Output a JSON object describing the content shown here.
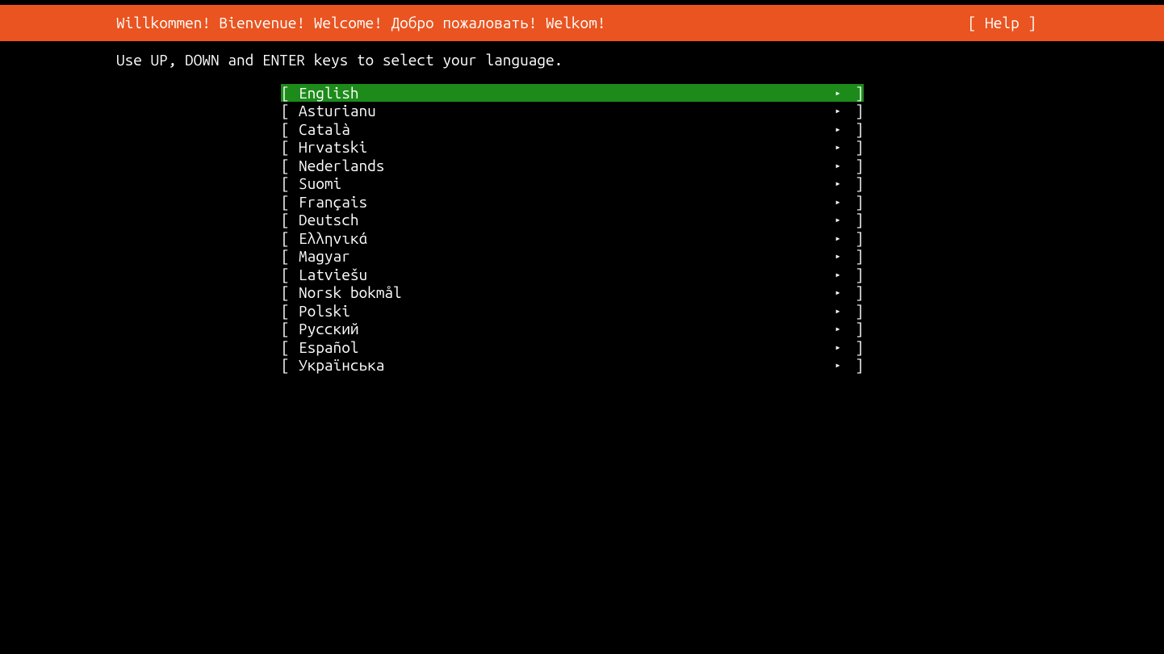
{
  "header": {
    "title": "Willkommen! Bienvenue! Welcome! Добро пожаловать! Welkom!",
    "help_label": "[ Help ]"
  },
  "instruction": "Use UP, DOWN and ENTER keys to select your language.",
  "languages": [
    {
      "label": "English",
      "selected": true
    },
    {
      "label": "Asturianu",
      "selected": false
    },
    {
      "label": "Català",
      "selected": false
    },
    {
      "label": "Hrvatski",
      "selected": false
    },
    {
      "label": "Nederlands",
      "selected": false
    },
    {
      "label": "Suomi",
      "selected": false
    },
    {
      "label": "Français",
      "selected": false
    },
    {
      "label": "Deutsch",
      "selected": false
    },
    {
      "label": "Ελληνικά",
      "selected": false
    },
    {
      "label": "Magyar",
      "selected": false
    },
    {
      "label": "Latviešu",
      "selected": false
    },
    {
      "label": "Norsk bokmål",
      "selected": false
    },
    {
      "label": "Polski",
      "selected": false
    },
    {
      "label": "Русский",
      "selected": false
    },
    {
      "label": "Español",
      "selected": false
    },
    {
      "label": "Українська",
      "selected": false
    }
  ],
  "glyphs": {
    "bracket_open": "[",
    "bracket_close": "]",
    "arrow_right": "▸"
  }
}
